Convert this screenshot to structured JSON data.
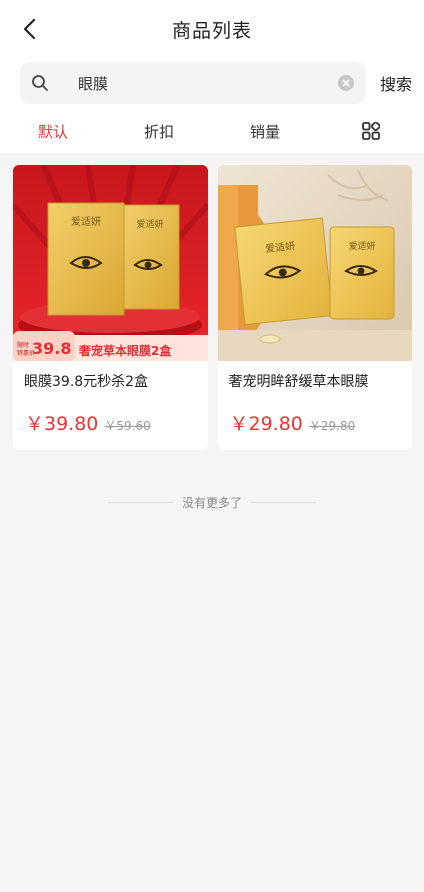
{
  "header": {
    "title": "商品列表"
  },
  "search": {
    "value": "眼膜",
    "button_label": "搜索"
  },
  "tabs": [
    {
      "label": "默认",
      "active": true
    },
    {
      "label": "折扣",
      "active": false
    },
    {
      "label": "销量",
      "active": false
    }
  ],
  "layout_toggle_icon": "grid-icon",
  "products": [
    {
      "title": "眼膜39.8元秒杀2盒",
      "price": "￥39.80",
      "original_price": "￥59.60",
      "image_badge": {
        "small_text": "限时 特惠价",
        "price": "39.8",
        "caption": "奢宠草本眼膜2盒"
      },
      "box_brand": "爱适妍"
    },
    {
      "title": "奢宠明眸舒缓草本眼膜",
      "price": "￥29.80",
      "original_price": "￥29.80",
      "box_brand": "爱适妍"
    }
  ],
  "footer": {
    "text": "没有更多了"
  },
  "colors": {
    "accent": "#e53535",
    "muted": "#9a9a9a"
  }
}
